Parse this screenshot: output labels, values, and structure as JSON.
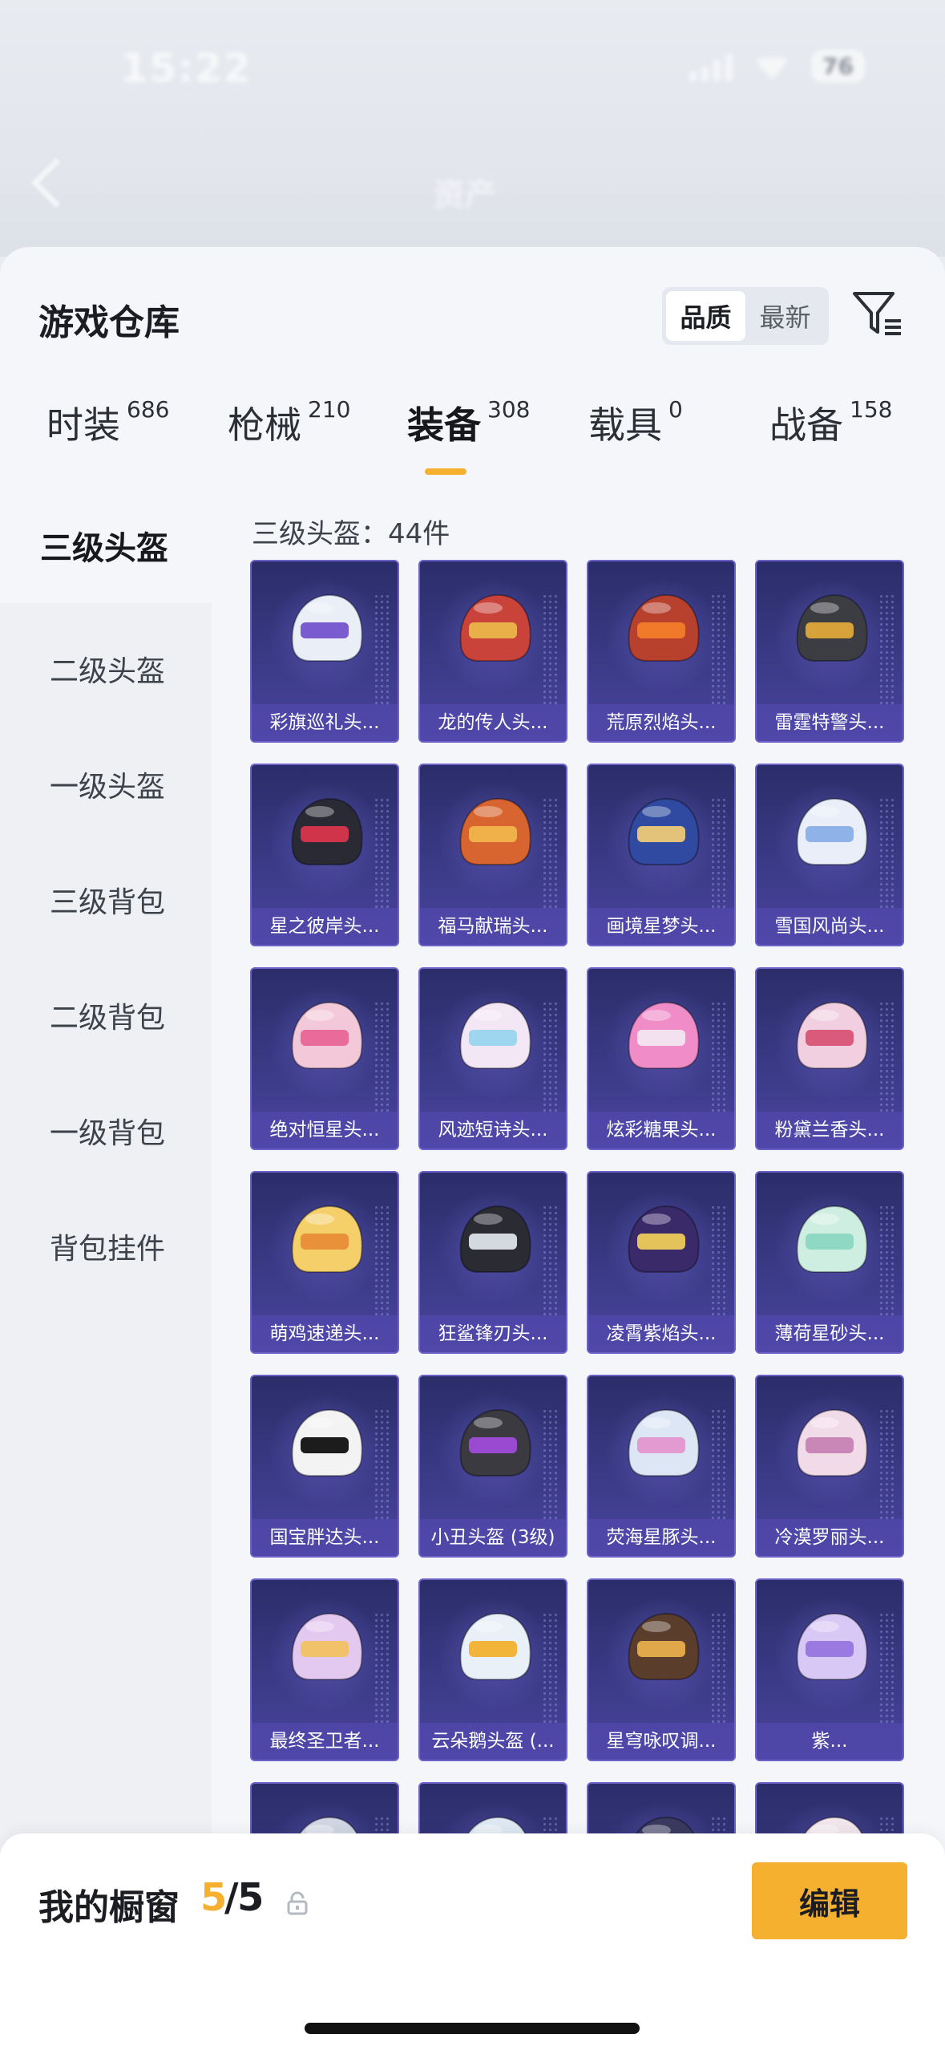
{
  "status_bar": {
    "time": "15:22",
    "battery": "76"
  },
  "header": {
    "ghost_title": "资产"
  },
  "sheet": {
    "title": "游戏仓库",
    "sort_options": [
      "品质",
      "最新"
    ],
    "sort_active": "品质"
  },
  "tabs": [
    {
      "label": "时装",
      "count": "686"
    },
    {
      "label": "枪械",
      "count": "210"
    },
    {
      "label": "装备",
      "count": "308"
    },
    {
      "label": "载具",
      "count": "0"
    },
    {
      "label": "战备",
      "count": "158"
    }
  ],
  "active_tab": "装备",
  "subcategories": [
    "三级头盔",
    "二级头盔",
    "一级头盔",
    "三级背包",
    "二级背包",
    "一级背包",
    "背包挂件"
  ],
  "active_subcategory": "三级头盔",
  "count_label": "三级头盔：44件",
  "items": [
    {
      "name": "彩旗巡礼头...",
      "color": "#e9eef7",
      "accent": "#7a5bd0"
    },
    {
      "name": "龙的传人头...",
      "color": "#c9433a",
      "accent": "#e9b04a"
    },
    {
      "name": "荒原烈焰头...",
      "color": "#b8412e",
      "accent": "#f07a2a"
    },
    {
      "name": "雷霆特警头...",
      "color": "#3c3d42",
      "accent": "#d7a23a"
    },
    {
      "name": "星之彼岸头...",
      "color": "#2a2a35",
      "accent": "#d0344a"
    },
    {
      "name": "福马献瑞头...",
      "color": "#d8642f",
      "accent": "#f0b04a"
    },
    {
      "name": "画境星梦头...",
      "color": "#2f4aa0",
      "accent": "#e3c37a"
    },
    {
      "name": "雪国风尚头...",
      "color": "#e9eef8",
      "accent": "#8fb2e8"
    },
    {
      "name": "绝对恒星头...",
      "color": "#f3c9d9",
      "accent": "#e86b9a"
    },
    {
      "name": "风迹短诗头...",
      "color": "#f3e7f5",
      "accent": "#9fd6ef"
    },
    {
      "name": "炫彩糖果头...",
      "color": "#f08cc8",
      "accent": "#f4e1f0"
    },
    {
      "name": "粉黛兰香头...",
      "color": "#f2cfe0",
      "accent": "#d95a7a"
    },
    {
      "name": "萌鸡速递头...",
      "color": "#f5cf6a",
      "accent": "#e8903a"
    },
    {
      "name": "狂鲨锋刃头...",
      "color": "#2a2b33",
      "accent": "#d4d8e0"
    },
    {
      "name": "凌霄紫焰头...",
      "color": "#3b2a6a",
      "accent": "#e3c35a"
    },
    {
      "name": "薄荷星砂头...",
      "color": "#cfeee2",
      "accent": "#8fd9c4"
    },
    {
      "name": "国宝胖达头...",
      "color": "#f3f3f3",
      "accent": "#1c1c1c"
    },
    {
      "name": "小丑头盔 (3级)",
      "color": "#3a3a40",
      "accent": "#9a4ad0"
    },
    {
      "name": "荧海星豚头...",
      "color": "#dce6f5",
      "accent": "#e39ad0"
    },
    {
      "name": "冷漠罗丽头...",
      "color": "#f2dbe8",
      "accent": "#c987b8"
    },
    {
      "name": "最终圣卫者...",
      "color": "#e3c8f0",
      "accent": "#f1c26a"
    },
    {
      "name": "云朵鹅头盔 (...",
      "color": "#e9f0f7",
      "accent": "#f2b53a"
    },
    {
      "name": "星穹咏叹调...",
      "color": "#5a3d2a",
      "accent": "#e0a84a"
    },
    {
      "name": "紫...",
      "color": "#d7c8f5",
      "accent": "#9a7ae0"
    },
    {
      "name": "",
      "color": "#d0d6e3",
      "accent": "#8aa0c8"
    },
    {
      "name": "",
      "color": "#dde8f2",
      "accent": "#f0c75a"
    },
    {
      "name": "",
      "color": "#3a3a60",
      "accent": "#7a6ad0"
    },
    {
      "name": "",
      "color": "#f1e6ec",
      "accent": "#d9444a"
    }
  ],
  "bottom_bar": {
    "label": "我的橱窗",
    "current": "5",
    "separator": "/",
    "max": "5",
    "edit_button": "编辑"
  },
  "colors": {
    "accent": "#f4b02e",
    "card_bg": "#3a3a86",
    "card_border": "#6c62c8",
    "name_bar": "#5048aa"
  }
}
